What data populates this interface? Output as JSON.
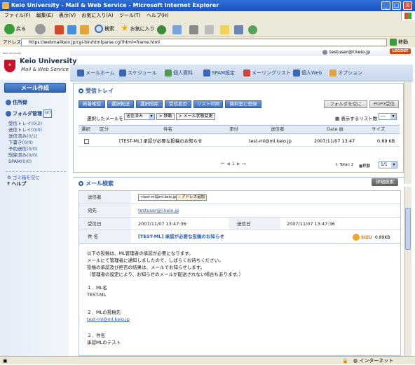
{
  "window": {
    "title": "Keio University - Mail & Web Service - Microsoft Internet Explorer",
    "min": "_",
    "max": "□",
    "close": "X"
  },
  "menu": [
    "ファイル(F)",
    "編集(E)",
    "表示(V)",
    "お気に入り(A)",
    "ツール(T)",
    "ヘルプ(H)"
  ],
  "toolbar": {
    "back": "戻る",
    "search": "検索",
    "favorites": "お気に入り"
  },
  "address": {
    "label": "アドレス(D)",
    "url": "https://webmailkeio.jp/cgi-bin/htmlparse.cgi?html=frame.html",
    "go": "移動"
  },
  "brand": {
    "line1": "Keio University",
    "line2": "Mail & Web Service",
    "tiny": "Keio University",
    "shield": "✦"
  },
  "user": {
    "email": "testuser@l.keio.jp",
    "logout": "LOGOUT"
  },
  "nav": [
    "メールホーム",
    "スケジュール",
    "個人資料",
    "SPAM設定",
    "メーリングリスト",
    "個人Web",
    "オプション"
  ],
  "sidebar": {
    "compose": "メール作成",
    "address_book": "住所録",
    "folder_manage": "フォルダ管理",
    "folder_badge": "SET",
    "folders": [
      {
        "name": "受信トレイ",
        "count": "(0/2)"
      },
      {
        "name": "送信トレイ",
        "count": "(0/0)"
      },
      {
        "name": "送信済み",
        "count": "(0/1)"
      },
      {
        "name": "下書き",
        "count": "(0/0)"
      },
      {
        "name": "予約送信",
        "count": "(0/0)"
      },
      {
        "name": "削除済み",
        "count": "(0/0)"
      },
      {
        "name": "SPAM",
        "count": "(0/0)"
      }
    ],
    "trash": "ゴミ箱を空に",
    "help": "ヘルプ"
  },
  "inbox": {
    "title": "受信トレイ",
    "buttons": [
      "新着確認",
      "選択転送",
      "選択削除",
      "受信拒否",
      "リスト印刷",
      "資料室に登録"
    ],
    "right_buttons": [
      "フォルダを空に",
      "POP3受信"
    ],
    "selected_label": "選択したメールを",
    "selected_value": "送信済み",
    "move": "移動",
    "mail_state": "メール状態変更",
    "list_count_label": "表示するリスト数",
    "list_count_value": "---",
    "columns": [
      "選択",
      "区分",
      "件名",
      "添付",
      "送信者",
      "Date",
      "サイズ"
    ],
    "rows": [
      {
        "subject": "[TEST-ML] 承認が必要な投稿のお知らせ",
        "sender": "test-ml@ml.keio.jp",
        "date": "2007/11/07 13:47",
        "size": "0.89 KB"
      }
    ],
    "pager_page": "1",
    "total": "Total: 2",
    "move_label": "移動",
    "page_select": "1/1"
  },
  "search": {
    "title": "メール検索",
    "detail": "詳細検索"
  },
  "message": {
    "from_label": "送信者",
    "from_value": "<test-ml@ml.keio.jp>",
    "add_address": "アドレス追加",
    "to_label": "宛先",
    "to_value": "testuser@l.keio.jp",
    "recv_label": "受信日",
    "recv_value": "2007/11/07 13:47:36",
    "sent_label": "送信日",
    "sent_value": "2007/11/07 13:47:36",
    "subject_label": "件 名",
    "subject_value": "[TEST-ML] 承認が必要な投稿のお知らせ",
    "logo": "SIZU",
    "size": "0.89KB",
    "body": [
      "以下の投稿は、ML管理者の承認が必要になります。",
      "メールにて管理者に通知しましたので、しばらくお待ちください。",
      "投稿の承認及び拒否の結果は、メールでお知らせします。",
      "（管理者の設定により、お知らせのメールが配送されない場合もあります。）",
      "",
      "１．ML名",
      "TEST-ML",
      "",
      "２．MLの投稿先",
      "test-ml@ml.keio.jp",
      "",
      "３．件名",
      "承認MLのテスト"
    ]
  },
  "status": {
    "zone": "インターネット"
  }
}
